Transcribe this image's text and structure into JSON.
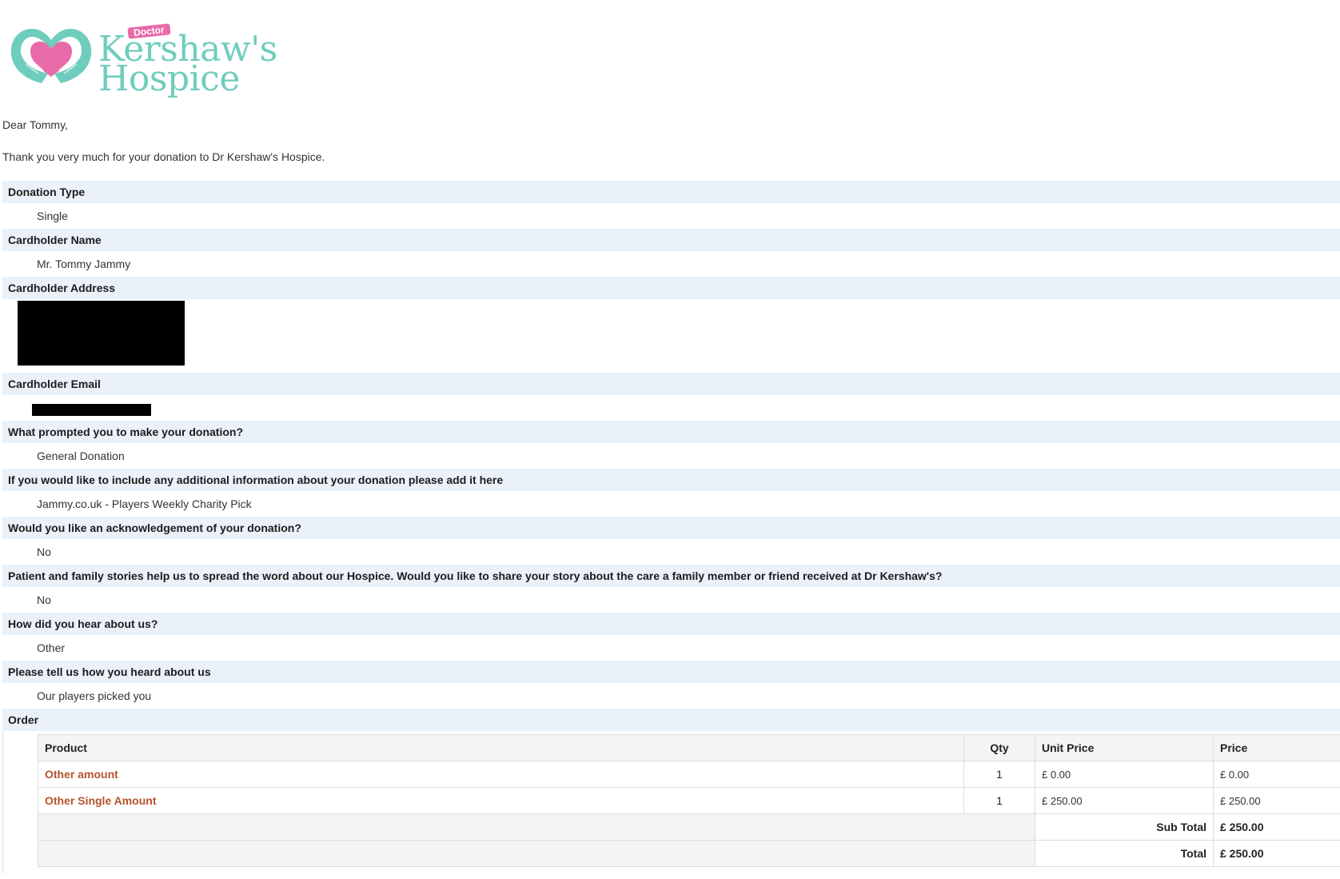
{
  "logo": {
    "badge": "Doctor",
    "line1": "Kershaw's",
    "line2": "Hospice",
    "colors": {
      "teal": "#6fcdbd",
      "pink": "#e96aa8"
    }
  },
  "greeting": "Dear Tommy,",
  "thanks": "Thank you very much for your donation to Dr Kershaw's Hospice.",
  "details": [
    {
      "question": "Donation Type",
      "answer": "Single"
    },
    {
      "question": "Cardholder Name",
      "answer": "Mr. Tommy Jammy"
    },
    {
      "question": "Cardholder Address",
      "answer": ""
    },
    {
      "question": "Cardholder Email",
      "answer": ""
    },
    {
      "question": "What prompted you to make your donation?",
      "answer": "General Donation"
    },
    {
      "question": "If you would like to include any additional information about your donation please add it here",
      "answer": "Jammy.co.uk - Players Weekly Charity Pick"
    },
    {
      "question": "Would you like an acknowledgement of your donation?",
      "answer": "No"
    },
    {
      "question": "Patient and family stories help us to spread the word about our Hospice. Would you like to share your story about the care a family member or friend received at Dr Kershaw's?",
      "answer": "No"
    },
    {
      "question": "How did you hear about us?",
      "answer": "Other"
    },
    {
      "question": "Please tell us how you heard about us",
      "answer": "Our players picked you"
    },
    {
      "question": "Order",
      "answer": ""
    }
  ],
  "order": {
    "headers": {
      "product": "Product",
      "qty": "Qty",
      "unit_price": "Unit Price",
      "price": "Price"
    },
    "rows": [
      {
        "product": "Other amount",
        "qty": "1",
        "unit_price": "£ 0.00",
        "price": "£ 0.00"
      },
      {
        "product": "Other Single Amount",
        "qty": "1",
        "unit_price": "£ 250.00",
        "price": "£ 250.00"
      }
    ],
    "subtotal_label": "Sub Total",
    "subtotal": "£ 250.00",
    "total_label": "Total",
    "total": "£ 250.00"
  }
}
